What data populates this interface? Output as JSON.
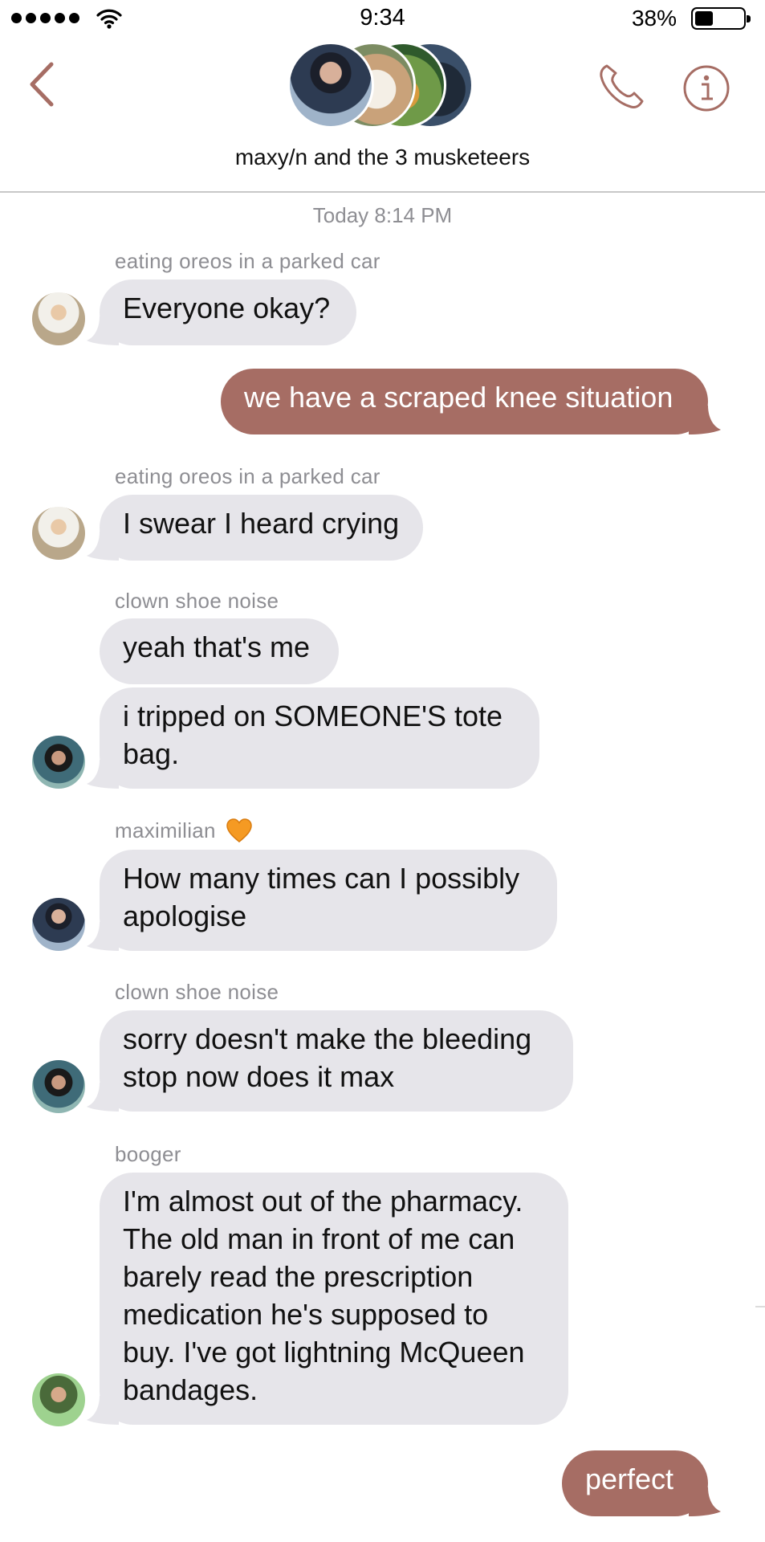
{
  "status_bar": {
    "time": "9:34",
    "battery": "38%",
    "battery_level": 0.38
  },
  "header": {
    "group_name": "maxy/n and the 3 musketeers"
  },
  "colors": {
    "accent": "#a66d64",
    "bubble_in": "#e6e5ea",
    "sender_gray": "#8e8e93"
  },
  "icons": {
    "back": "chevron-left-icon",
    "call": "phone-icon",
    "details": "info-icon"
  },
  "conversation": {
    "timestamp": "Today 8:14 PM",
    "messages": [
      {
        "sender": "eating oreos in a parked car",
        "text": "Everyone okay?",
        "direction": "incoming"
      },
      {
        "text": "we have a scraped knee situation",
        "direction": "outgoing"
      },
      {
        "sender": "eating oreos in a parked car",
        "text": "I swear I heard crying",
        "direction": "incoming"
      },
      {
        "sender": "clown shoe noise",
        "text": "yeah that's me",
        "direction": "incoming"
      },
      {
        "text": "i tripped on SOMEONE'S tote bag.",
        "direction": "incoming"
      },
      {
        "sender": "maximilian",
        "sender_emoji": "orange-heart-icon",
        "text": "How many times can I possibly apologise",
        "direction": "incoming"
      },
      {
        "sender": "clown shoe noise",
        "text": "sorry doesn't make the bleeding stop now does it max",
        "direction": "incoming"
      },
      {
        "sender": "booger",
        "text": "I'm almost out of the pharmacy. The old man in front of me can barely read the prescription medication he's supposed to buy. I've got lightning McQueen bandages.",
        "direction": "incoming"
      },
      {
        "text": "perfect",
        "direction": "outgoing"
      }
    ]
  }
}
